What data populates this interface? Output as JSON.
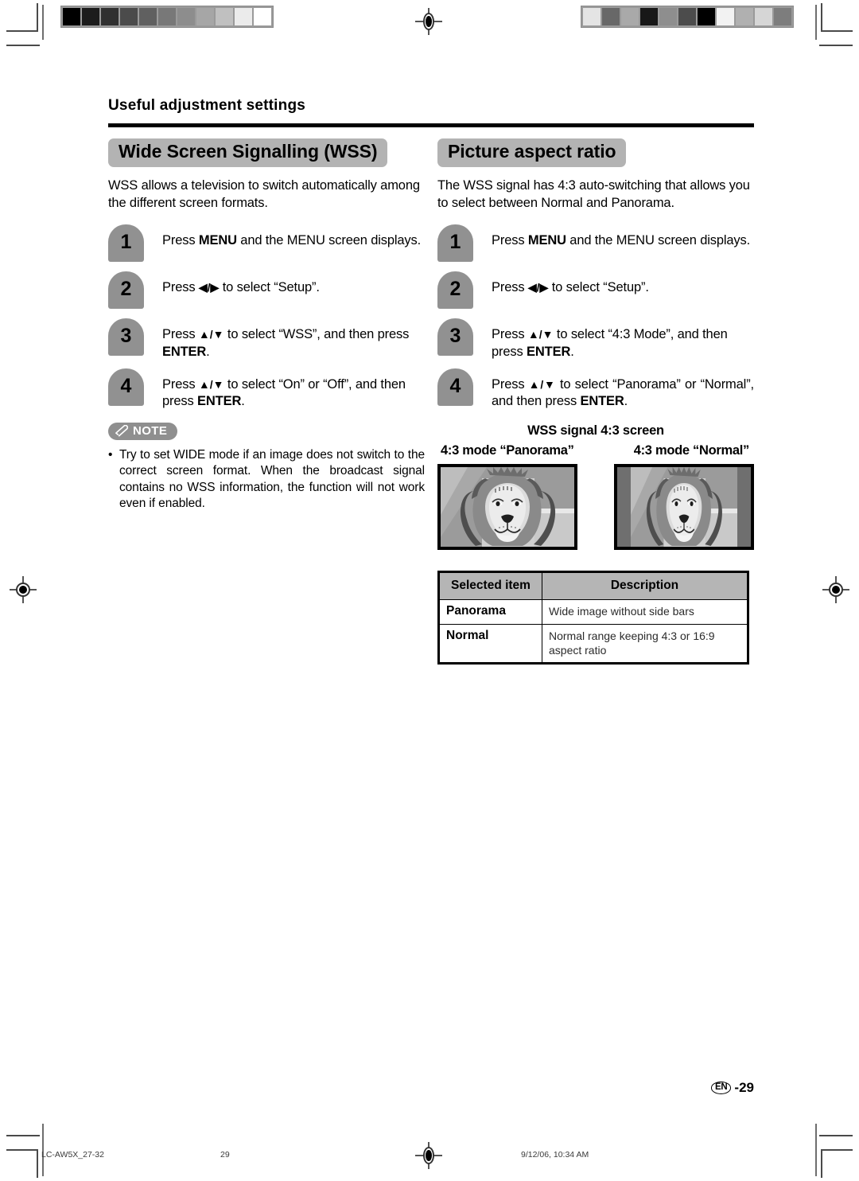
{
  "running_head": "Useful adjustment settings",
  "left_column": {
    "section_title": "Wide Screen Signalling (WSS)",
    "intro": "WSS allows a television to switch automatically among the different screen formats.",
    "steps": [
      {
        "number": "1",
        "text_before": "Press ",
        "bold1": "MENU",
        "text_mid": " and the MENU screen displays.",
        "bold2": "",
        "text_after": ""
      },
      {
        "number": "2",
        "text_before": "Press ",
        "bold1": "◀/▶",
        "text_mid": " to select “Setup”.",
        "bold2": "",
        "text_after": ""
      },
      {
        "number": "3",
        "text_before": "Press ",
        "bold1": "▲/▼",
        "text_mid": " to select “WSS”, and then press ",
        "bold2": "ENTER",
        "text_after": "."
      },
      {
        "number": "4",
        "text_before": "Press ",
        "bold1": "▲/▼",
        "text_mid": " to select “On” or “Off”, and then press ",
        "bold2": "ENTER",
        "text_after": "."
      }
    ],
    "note": {
      "label": "NOTE",
      "icon": "pen-icon",
      "bullet": "•",
      "text": "Try to set WIDE mode if an image does not switch to the correct screen format. When the broadcast signal contains no WSS information, the function will not work even if enabled."
    }
  },
  "right_column": {
    "section_title": "Picture aspect ratio",
    "intro": "The WSS signal has 4:3 auto-switching that allows you to select between Normal and Panorama.",
    "steps": [
      {
        "number": "1",
        "text_before": "Press ",
        "bold1": "MENU",
        "text_mid": " and the MENU screen displays.",
        "bold2": "",
        "text_after": ""
      },
      {
        "number": "2",
        "text_before": "Press ",
        "bold1": "◀/▶",
        "text_mid": " to select “Setup”.",
        "bold2": "",
        "text_after": ""
      },
      {
        "number": "3",
        "text_before": "Press ",
        "bold1": "▲/▼",
        "text_mid": " to select “4:3 Mode”, and then press ",
        "bold2": "ENTER",
        "text_after": "."
      },
      {
        "number": "4",
        "text_before": "Press ",
        "bold1": "▲/▼",
        "text_mid": " to select “Panorama” or “Normal”, and then press ",
        "bold2": "ENTER",
        "text_after": "."
      }
    ],
    "preview": {
      "caption": "WSS signal 4:3 screen",
      "mode_panorama_label": "4:3 mode “Panorama”",
      "mode_normal_label": "4:3 mode “Normal”",
      "image_alt_panorama": "lion-photo-panorama",
      "image_alt_normal": "lion-photo-normal"
    },
    "table": {
      "headers": [
        "Selected item",
        "Description"
      ],
      "rows": [
        {
          "item": "Panorama",
          "desc": "Wide image without side bars"
        },
        {
          "item": "Normal",
          "desc": "Normal range keeping 4:3 or 16:9 aspect ratio"
        }
      ]
    }
  },
  "folio": {
    "lang": "EN",
    "page": "-29"
  },
  "footer": {
    "file": "LC-AW5X_27-32",
    "page": "29",
    "date": "9/12/06, 10:34 AM"
  },
  "print_marks": {
    "grayscale_wedge_left": [
      "#000000",
      "#1c1c1c",
      "#303030",
      "#4b4b4b",
      "#606060",
      "#787878",
      "#8d8d8d",
      "#a6a6a6",
      "#c0c0c0",
      "#ebebeb",
      "#ffffff"
    ],
    "grayscale_wedge_right": [
      "#e4e4e4",
      "#686868",
      "#a9a9a9",
      "#181818",
      "#8e8e8e",
      "#4c4c4c",
      "#000000",
      "#f2f2f2",
      "#b0b0b0",
      "#d6d6d6",
      "#7d7d7d"
    ]
  }
}
